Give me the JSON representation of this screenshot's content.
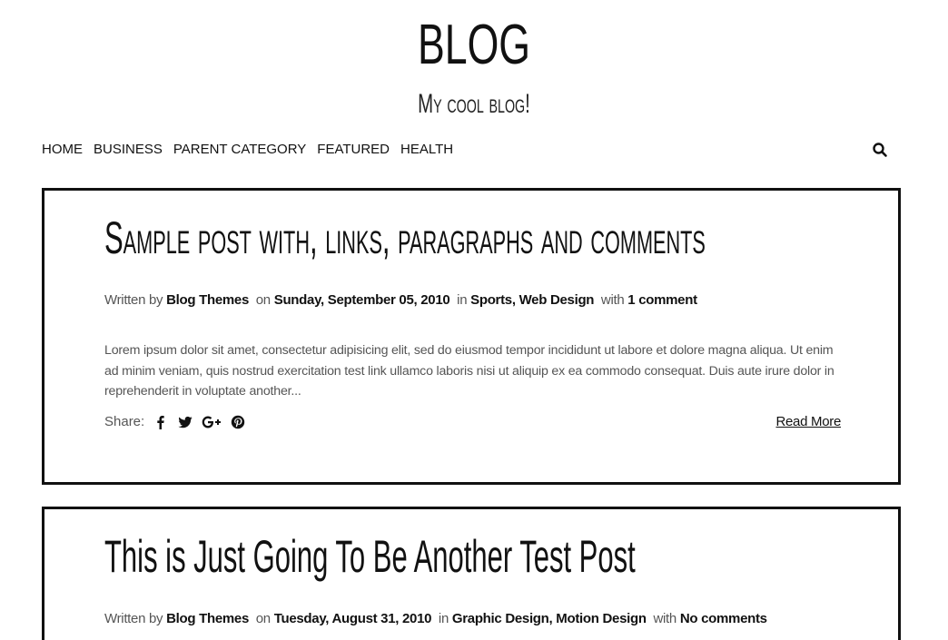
{
  "site": {
    "title": "BLOG",
    "tagline": "My cool blog!"
  },
  "nav": {
    "items": [
      {
        "label": "HOME"
      },
      {
        "label": "BUSINESS"
      },
      {
        "label": "PARENT CATEGORY"
      },
      {
        "label": "FEATURED"
      },
      {
        "label": "HEALTH"
      }
    ],
    "search_icon": "search-icon"
  },
  "posts": [
    {
      "title": "Sample post with, links, paragraphs and comments",
      "meta": {
        "written_by": "Written by",
        "author": "Blog Themes",
        "on": "on",
        "date": "Sunday, September 05, 2010",
        "in": "in",
        "categories": [
          "Sports",
          "Web Design"
        ],
        "with": "with",
        "comments": "1 comment"
      },
      "excerpt": "Lorem ipsum dolor sit amet, consectetur adipisicing elit, sed do eiusmod tempor incididunt ut labore et dolore magna aliqua. Ut enim ad minim veniam, quis nostrud exercitation test link ullamco laboris nisi ut aliquip ex ea commodo consequat. Duis aute irure dolor in reprehenderit in voluptate another...",
      "share_label": "Share:",
      "share_icons": [
        "facebook-icon",
        "twitter-icon",
        "google-plus-icon",
        "pinterest-icon"
      ],
      "read_more": "Read More"
    },
    {
      "title": "This is Just Going To Be Another Test Post",
      "meta": {
        "written_by": "Written by",
        "author": "Blog Themes",
        "on": "on",
        "date": "Tuesday, August 31, 2010",
        "in": "in",
        "categories": [
          "Graphic Design",
          "Motion Design"
        ],
        "with": "with",
        "comments": "No comments"
      }
    }
  ],
  "colors": {
    "text": "#111111",
    "muted": "#555555",
    "border": "#111111",
    "background": "#ffffff"
  }
}
